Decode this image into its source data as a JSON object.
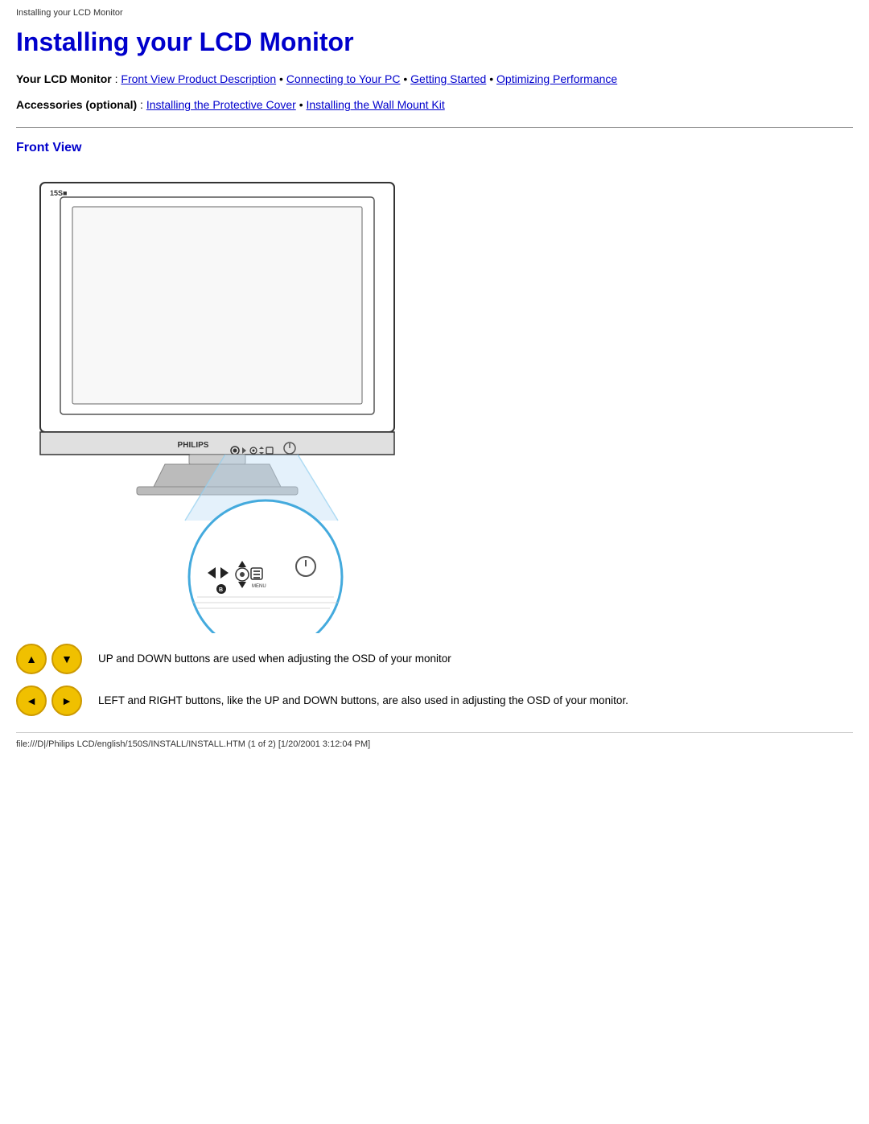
{
  "browser_tab": {
    "text": "Installing your LCD Monitor"
  },
  "page": {
    "title": "Installing your LCD Monitor"
  },
  "nav": {
    "lcd_label": "Your LCD Monitor",
    "links": [
      {
        "id": "front-view",
        "text": "Front View Product Description"
      },
      {
        "id": "connecting",
        "text": "Connecting to Your PC"
      },
      {
        "id": "getting-started",
        "text": "Getting Started"
      },
      {
        "id": "optimizing",
        "text": "Optimizing Performance"
      }
    ],
    "accessories_label": "Accessories (optional)",
    "accessory_links": [
      {
        "id": "protective-cover",
        "text": "Installing the Protective Cover"
      },
      {
        "id": "wall-mount",
        "text": "Installing the Wall Mount Kit"
      }
    ]
  },
  "front_view": {
    "title": "Front View"
  },
  "button_legends": [
    {
      "id": "up-down",
      "icons": [
        "▲",
        "▼"
      ],
      "text": "UP and DOWN buttons are used when adjusting the OSD of your monitor"
    },
    {
      "id": "left-right",
      "icons": [
        "◄",
        "►"
      ],
      "text": "LEFT and RIGHT buttons, like the UP and DOWN buttons, are also used in adjusting the OSD of your monitor."
    }
  ],
  "footer": {
    "text": "file:///D|/Philips LCD/english/150S/INSTALL/INSTALL.HTM (1 of 2) [1/20/2001 3:12:04 PM]"
  }
}
